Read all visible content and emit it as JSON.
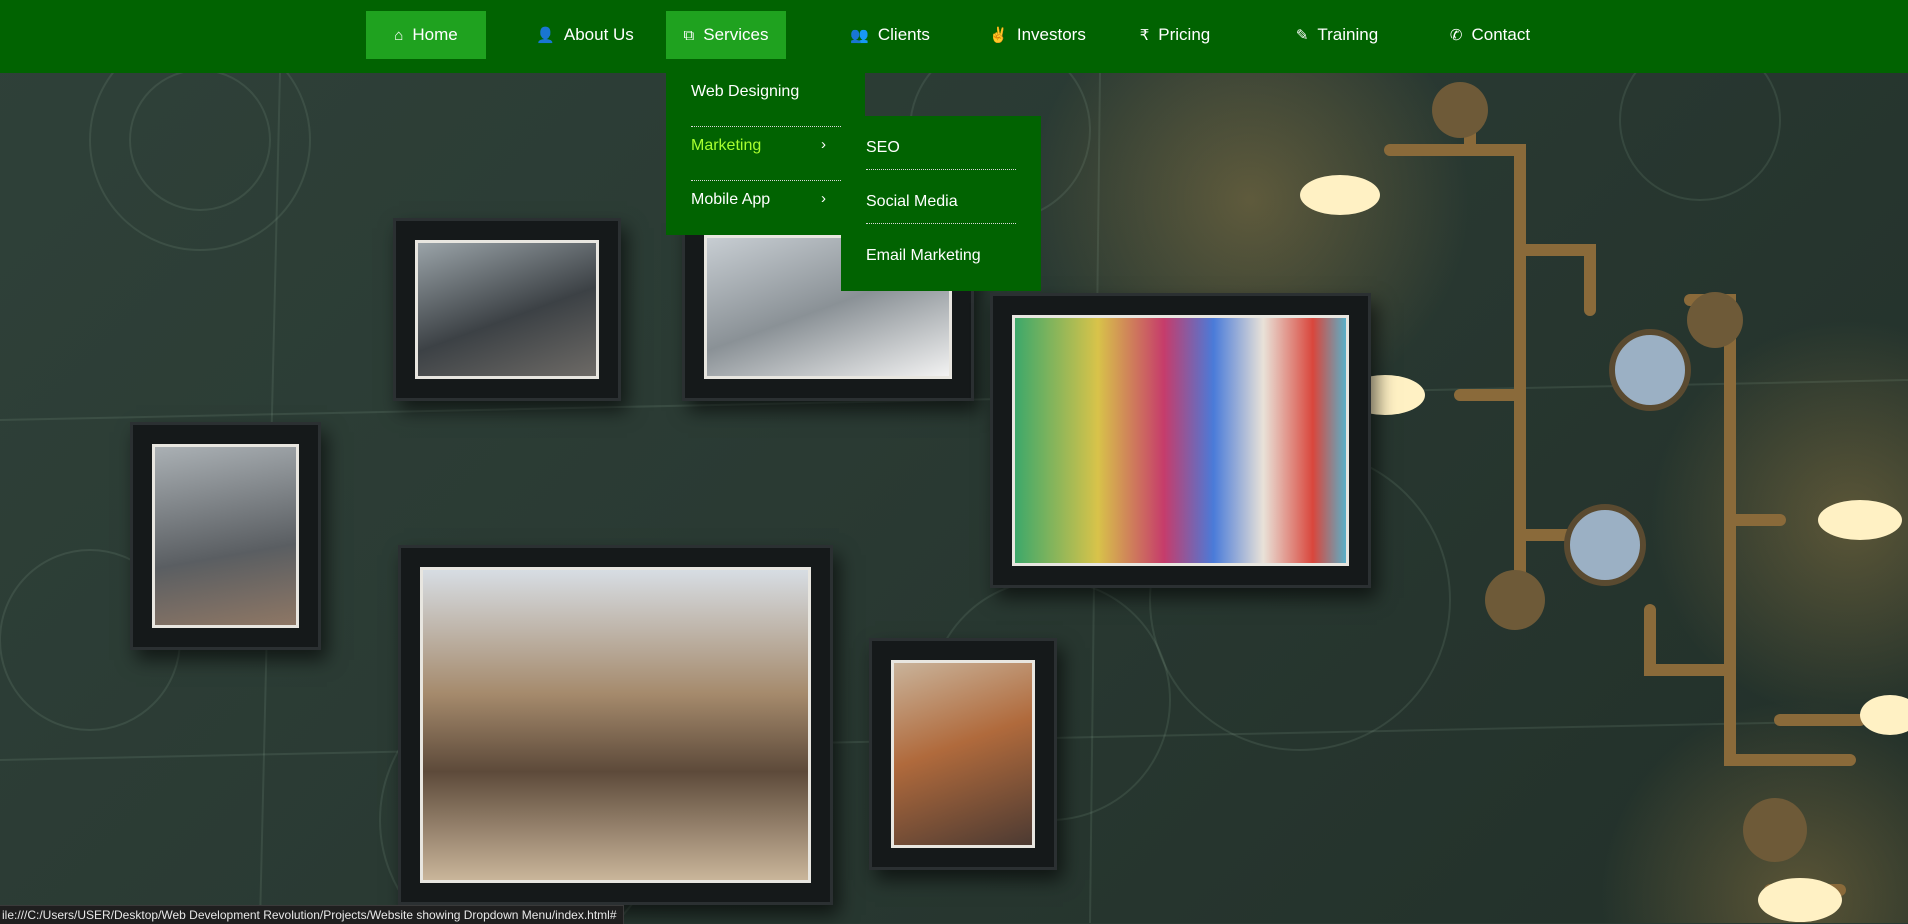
{
  "nav": {
    "items": [
      {
        "label": "Home",
        "icon": "home-icon"
      },
      {
        "label": "About Us",
        "icon": "user-icon"
      },
      {
        "label": "Services",
        "icon": "clone-icon"
      },
      {
        "label": "Clients",
        "icon": "users-icon"
      },
      {
        "label": "Investors",
        "icon": "hand-peace-icon"
      },
      {
        "label": "Pricing",
        "icon": "rupee-icon"
      },
      {
        "label": "Training",
        "icon": "edit-icon"
      },
      {
        "label": "Contact",
        "icon": "phone-icon"
      }
    ],
    "active_bg": "#1fa21f",
    "bar_bg": "#016301"
  },
  "dropdown": {
    "items": [
      {
        "label": "Web Designing"
      },
      {
        "label": "Marketing",
        "chevron": "›"
      },
      {
        "label": "Mobile App",
        "chevron": "›"
      }
    ],
    "highlight_color": "#a8ff30"
  },
  "submenu": {
    "items": [
      {
        "label": "SEO"
      },
      {
        "label": "Social Media"
      },
      {
        "label": "Email Marketing"
      }
    ]
  },
  "status": {
    "url": "ile:///C:/Users/USER/Desktop/Web Development Revolution/Projects/Website showing Dropdown Menu/index.html#"
  }
}
